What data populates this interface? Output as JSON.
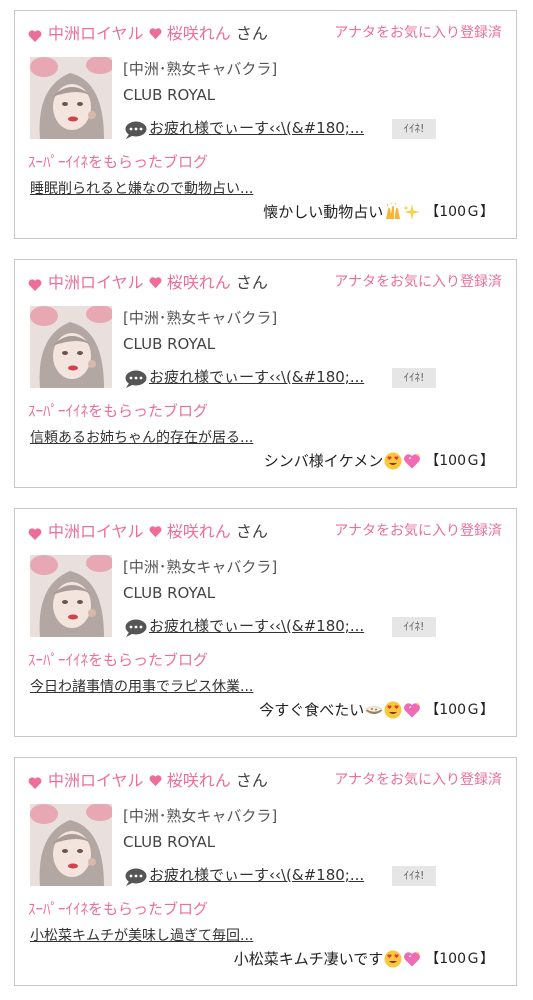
{
  "colors": {
    "accent_pink": "#ee6e9a",
    "border": "#c8c8c8",
    "button_bg": "#e6e6e6"
  },
  "posts": [
    {
      "shop_prefix": "中洲ロイヤル",
      "cast_name": "桜咲れん",
      "honorific": "さん",
      "favorite_status": "アナタをお気に入り登録済",
      "shop_genre": "[中洲･熟女キャバクラ]",
      "shop_name": "CLUB ROYAL",
      "message": "お疲れ様でぃーす‹‹\\(&#180;...",
      "iine_label": "ｲｲﾈ!",
      "super_label": "ｽｰﾊﾟｰｲｲﾈをもらったブログ",
      "blog_title": "睡眠削られると嫌なので動物占い...",
      "blog_text": "懐かしい動物占い",
      "emojis": [
        "raised-hands-icon",
        "sparkles-icon"
      ],
      "points": "【100Ｇ】"
    },
    {
      "shop_prefix": "中洲ロイヤル",
      "cast_name": "桜咲れん",
      "honorific": "さん",
      "favorite_status": "アナタをお気に入り登録済",
      "shop_genre": "[中洲･熟女キャバクラ]",
      "shop_name": "CLUB ROYAL",
      "message": "お疲れ様でぃーす‹‹\\(&#180;...",
      "iine_label": "ｲｲﾈ!",
      "super_label": "ｽｰﾊﾟｰｲｲﾈをもらったブログ",
      "blog_title": "信頼あるお姉ちゃん的存在が居る...",
      "blog_text": "シンバ様イケメン",
      "emojis": [
        "heart-eyes-icon",
        "sparkling-heart-icon"
      ],
      "points": "【100Ｇ】"
    },
    {
      "shop_prefix": "中洲ロイヤル",
      "cast_name": "桜咲れん",
      "honorific": "さん",
      "favorite_status": "アナタをお気に入り登録済",
      "shop_genre": "[中洲･熟女キャバクラ]",
      "shop_name": "CLUB ROYAL",
      "message": "お疲れ様でぃーす‹‹\\(&#180;...",
      "iine_label": "ｲｲﾈ!",
      "super_label": "ｽｰﾊﾟｰｲｲﾈをもらったブログ",
      "blog_title": "今日わ諸事情の用事でラピス休業...",
      "blog_text": "今すぐ食べたい",
      "emojis": [
        "food-bowl-icon",
        "heart-eyes-icon",
        "sparkling-heart-icon"
      ],
      "points": "【100Ｇ】"
    },
    {
      "shop_prefix": "中洲ロイヤル",
      "cast_name": "桜咲れん",
      "honorific": "さん",
      "favorite_status": "アナタをお気に入り登録済",
      "shop_genre": "[中洲･熟女キャバクラ]",
      "shop_name": "CLUB ROYAL",
      "message": "お疲れ様でぃーす‹‹\\(&#180;...",
      "iine_label": "ｲｲﾈ!",
      "super_label": "ｽｰﾊﾟｰｲｲﾈをもらったブログ",
      "blog_title": "小松菜キムチが美味し過ぎて毎回...",
      "blog_text": "小松菜キムチ凄いです",
      "emojis": [
        "heart-eyes-icon",
        "sparkling-heart-icon"
      ],
      "points": "【100Ｇ】"
    }
  ]
}
